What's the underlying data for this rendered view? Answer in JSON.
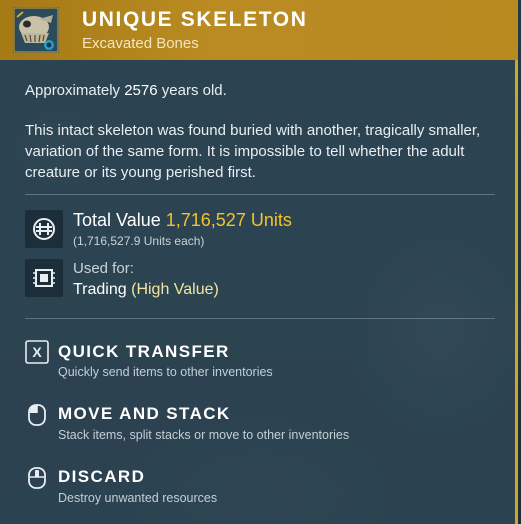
{
  "item": {
    "title": "UNIQUE SKELETON",
    "subtitle": "Excavated Bones",
    "icon": "skull-fossil-icon"
  },
  "age": {
    "prefix": "Approximately",
    "years": "2576",
    "suffix": "years old."
  },
  "description": "This intact skeleton was found buried with another, tragically smaller, variation of the same form. It is impossible to tell whether the adult creature or its young perished first.",
  "value": {
    "label": "Total Value",
    "amount": "1,716,527 Units",
    "each": "(1,716,527.9 Units each)",
    "icon": "units-currency-icon"
  },
  "usage": {
    "label": "Used for:",
    "value_prefix": "Trading",
    "value_highlight": "(High Value)",
    "icon": "trade-chip-icon"
  },
  "actions": [
    {
      "key": "X",
      "title": "QUICK TRANSFER",
      "desc": "Quickly send items to other inventories",
      "icon": "x-key-icon"
    },
    {
      "title": "MOVE AND STACK",
      "desc": "Stack items, split stacks or move to other inventories",
      "icon": "mouse-left-click-icon"
    },
    {
      "title": "DISCARD",
      "desc": "Destroy unwanted resources",
      "icon": "mouse-middle-click-icon"
    }
  ],
  "colors": {
    "header": "#b98a1f",
    "accent_border": "#d2a52a",
    "value": "#f2c32b",
    "highlight": "#efe6a1"
  }
}
